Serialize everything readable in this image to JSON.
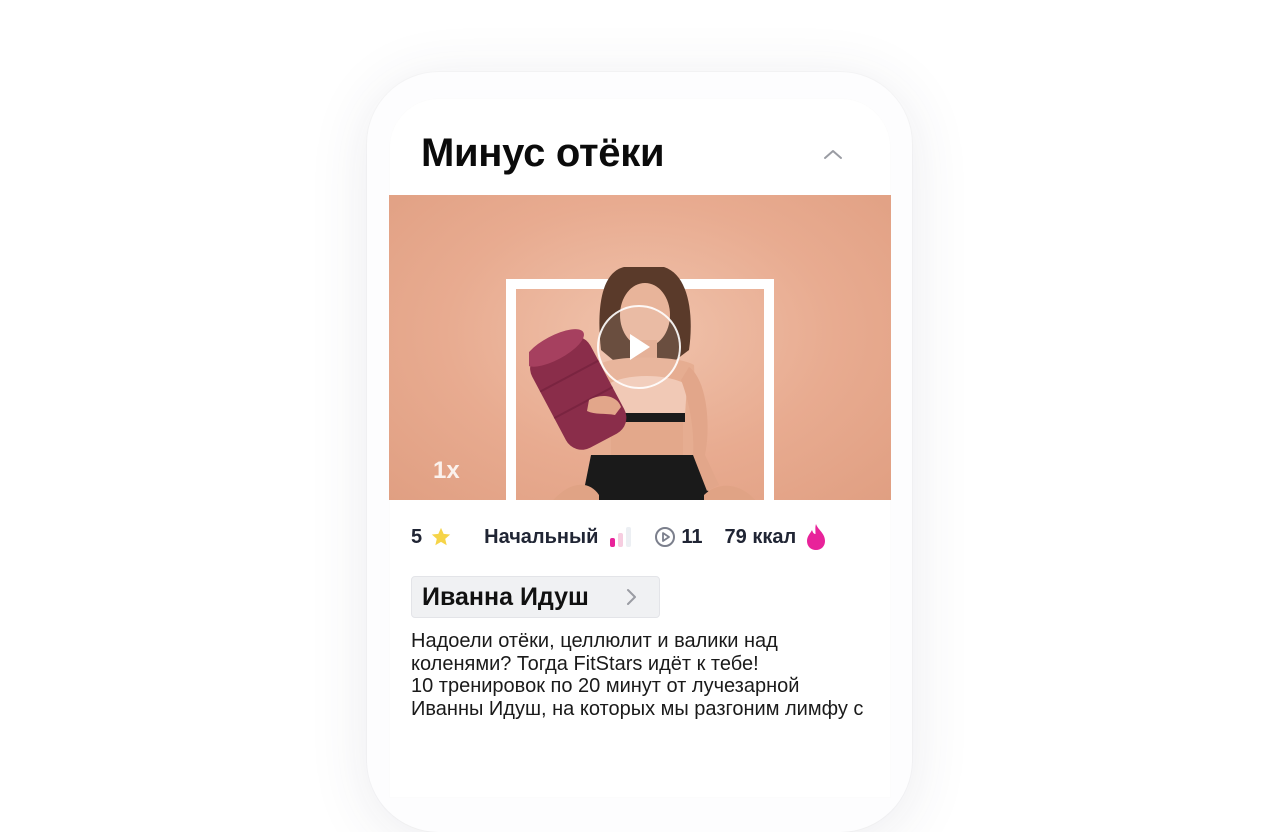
{
  "workout": {
    "title": "Минус отёки",
    "video": {
      "speed_label": "1x"
    },
    "stats": {
      "rating": "5",
      "level": "Начальный",
      "level_value": 1,
      "level_max": 3,
      "sessions": "11",
      "calories": "79 ккал"
    },
    "author": {
      "name": "Иванна Идуш"
    },
    "description_lines": [
      "Надоели отёки, целлюлит и валики над",
      "коленями? Тогда FitStars идёт к тебе!",
      "10 тренировок по 20 минут от лучезарной",
      "Иванны Идуш, на которых мы разгоним лимфу с"
    ]
  },
  "colors": {
    "accent": "#e8239a",
    "star": "#f6d448",
    "video_bg": "#e8ab90"
  },
  "icons": [
    "chevron-up-icon",
    "play-icon",
    "star-icon",
    "level-bars-icon",
    "play-circle-icon",
    "flame-icon",
    "chevron-right-icon"
  ]
}
